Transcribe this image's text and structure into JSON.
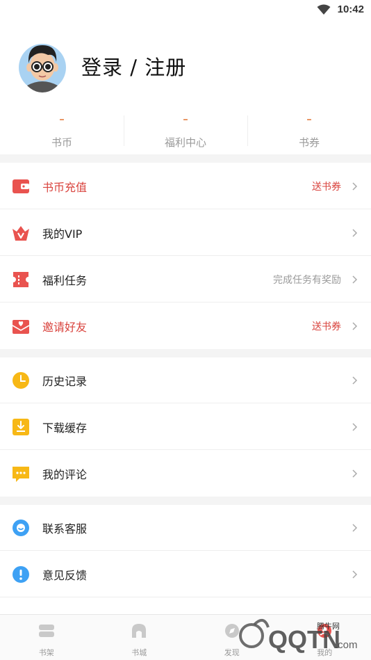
{
  "status_bar": {
    "time": "10:42",
    "wifi_icon": "wifi-icon"
  },
  "profile": {
    "avatar_icon": "avatar-icon",
    "login_label": "登录 / 注册"
  },
  "stats": [
    {
      "value": "–",
      "label": "书币"
    },
    {
      "value": "–",
      "label": "福利中心"
    },
    {
      "value": "–",
      "label": "书券"
    }
  ],
  "menu_group_1": [
    {
      "icon": "wallet-icon",
      "label": "书币充值",
      "right": "送书券",
      "highlight": true
    },
    {
      "icon": "vip-crown-icon",
      "label": "我的VIP",
      "right": "",
      "highlight": false
    },
    {
      "icon": "ticket-icon",
      "label": "福利任务",
      "right": "完成任务有奖励",
      "highlight": false
    },
    {
      "icon": "envelope-heart-icon",
      "label": "邀请好友",
      "right": "送书券",
      "highlight": true
    }
  ],
  "menu_group_2": [
    {
      "icon": "clock-icon",
      "label": "历史记录",
      "right": ""
    },
    {
      "icon": "download-icon",
      "label": "下载缓存",
      "right": ""
    },
    {
      "icon": "comment-icon",
      "label": "我的评论",
      "right": ""
    }
  ],
  "menu_group_3": [
    {
      "icon": "customer-service-icon",
      "label": "联系客服",
      "right": ""
    },
    {
      "icon": "feedback-icon",
      "label": "意见反馈",
      "right": ""
    }
  ],
  "tabs": [
    {
      "icon": "bookshelf-icon",
      "label": "书架"
    },
    {
      "icon": "bookstore-icon",
      "label": "书城"
    },
    {
      "icon": "discover-icon",
      "label": "发现"
    },
    {
      "icon": "mine-icon",
      "label": "我的"
    }
  ],
  "watermark": {
    "brand": "QQTN",
    "suffix": ".com",
    "sub": "腾牛网"
  },
  "colors": {
    "accent_red": "#d9433d",
    "stat_orange": "#e8925e",
    "clock_yellow": "#f7b816",
    "blue": "#3ea1f4"
  }
}
